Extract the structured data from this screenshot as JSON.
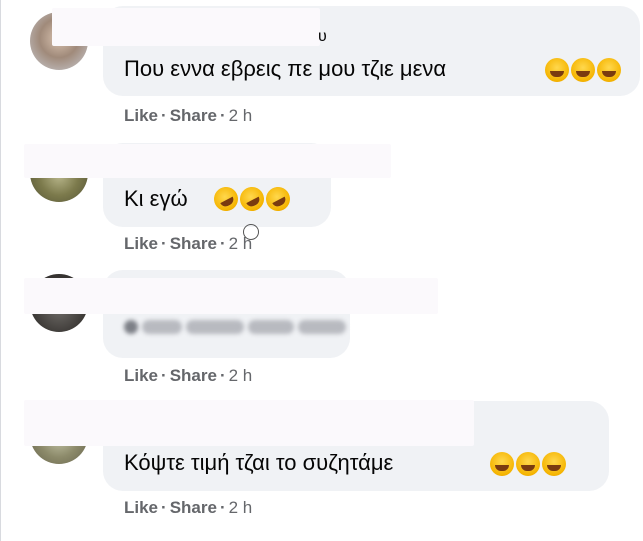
{
  "comments": [
    {
      "name_visible": "υ",
      "text": "Που εννα εβρεις πε μου τζιε μενα",
      "emojis": [
        "laughing-emoji",
        "laughing-emoji",
        "laughing-emoji"
      ],
      "like": "Like",
      "share": "Share",
      "time": "2 h"
    },
    {
      "text": "Κι εγώ",
      "emojis": [
        "rofl-emoji",
        "rofl-emoji",
        "rofl-emoji"
      ],
      "like": "Like",
      "share": "Share",
      "time": "2 h"
    },
    {
      "like": "Like",
      "share": "Share",
      "time": "2 h"
    },
    {
      "text": "Κόψτε τιμή τζαι το συζητάμε",
      "emojis": [
        "laughing-emoji",
        "laughing-emoji",
        "laughing-emoji"
      ],
      "like": "Like",
      "share": "Share",
      "time": "2 h"
    }
  ],
  "colors": {
    "bubble": "#f0f2f5",
    "text": "#050505",
    "meta": "#65676b",
    "redaction": "#fbf9fc",
    "emoji": "#f5b400"
  }
}
